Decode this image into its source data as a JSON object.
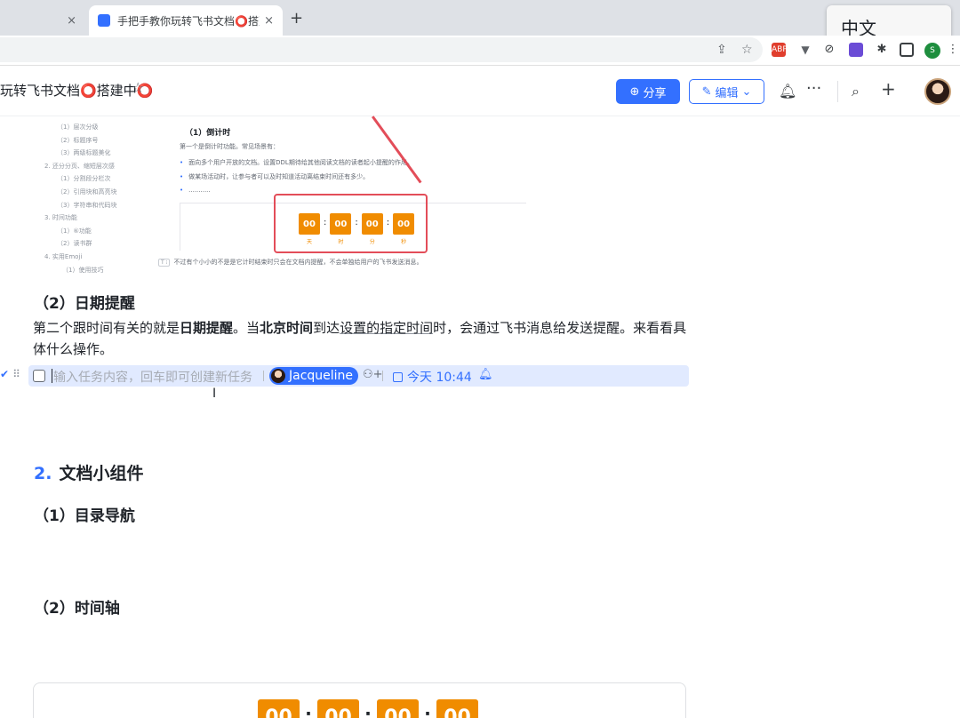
{
  "browser": {
    "inactive_tab_close": "×",
    "active_tab": {
      "title": "手把手教你玩转飞书文档⭕搭建中⭕",
      "close": "×"
    },
    "new_tab": "+",
    "ime": "中文",
    "extensions": {
      "adblock": "ABP",
      "profile": "S"
    }
  },
  "doc_header": {
    "title": "玩转飞书文档⭕搭建中⭕",
    "star_icon": "☆",
    "share_label": "分享",
    "edit_label": "编辑",
    "more_icon": "···",
    "add_icon": "+"
  },
  "embedded_image": {
    "toc": [
      "（1）层次分级",
      "（2）标题序号",
      "（3）两级标题美化",
      "2. 还分分页、缩短层次感",
      "（1）分割段分栏次",
      "（2）引用块和高亮块",
      "（3）字符串和代码块",
      "3. 时间功能",
      "（1）⑥功能",
      "（2）读书群",
      "4. 实用Emoji",
      "（1）使用技巧"
    ],
    "heading": "（1）倒计时",
    "intro": "第一个是倒计时功能。常见场景有：",
    "bullets": [
      "面向多个用户开放的文档。设置DDL期待给其他阅读文档的读者起小提醒的作用。",
      "做某场活动时，让参与者可以及时知道活动离结束时间还有多少。",
      "..........."
    ],
    "countdown": [
      {
        "value": "00",
        "unit": "天"
      },
      {
        "value": "00",
        "unit": "时"
      },
      {
        "value": "00",
        "unit": "分"
      },
      {
        "value": "00",
        "unit": "秒"
      }
    ],
    "caption_tag": "T ⁝",
    "caption": "不过有个小小的不是是它计时结束时只会在文档内提醒，不会单独给用户的飞书发送消息。"
  },
  "body": {
    "date_reminder_heading": "（2）日期提醒",
    "para_1": "第二个跟时间有关的就是",
    "para_bold_1": "日期提醒",
    "para_2": "。当",
    "para_bold_2": "北京时间",
    "para_3": "到达",
    "para_underline": "设置的指定时间",
    "para_4": "时，会通过飞书消息给发送提醒。来看看具体什么操作。",
    "task": {
      "placeholder": "输入任务内容，回车即可创建新任务",
      "assignee": "Jacqueline",
      "due": "今天 10:44"
    },
    "section2_num": "2.",
    "section2_title": "文档小组件",
    "toc_nav_heading": "（1）目录导航",
    "timeline_heading": "（2）时间轴",
    "widget_countdown": [
      "00",
      "00",
      "00",
      "00"
    ]
  }
}
